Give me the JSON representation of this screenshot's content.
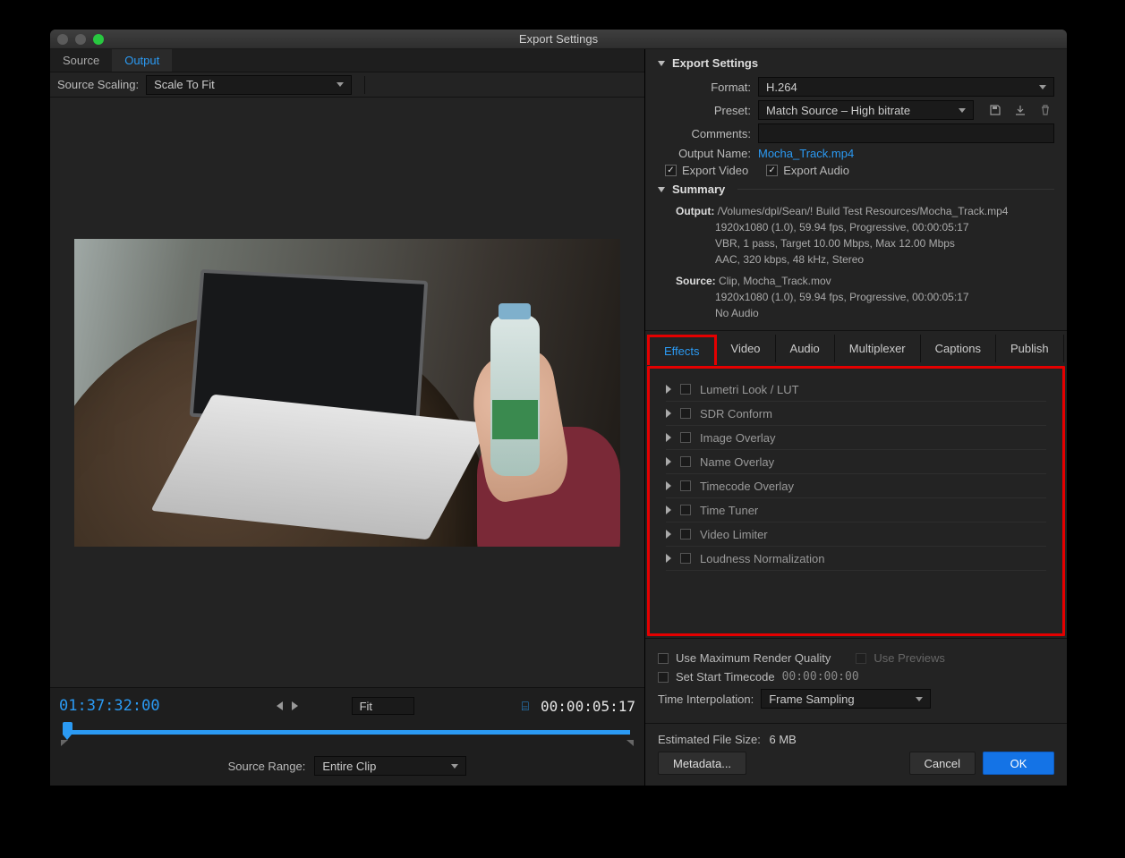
{
  "window": {
    "title": "Export Settings"
  },
  "left": {
    "tabs": [
      "Source",
      "Output"
    ],
    "active_tab": "Output",
    "scaling_label": "Source Scaling:",
    "scaling_value": "Scale To Fit",
    "timecode_in": "01:37:32:00",
    "timecode_out": "00:00:05:17",
    "zoom_value": "Fit",
    "range_label": "Source Range:",
    "range_value": "Entire Clip"
  },
  "export": {
    "header": "Export Settings",
    "format_label": "Format:",
    "format_value": "H.264",
    "preset_label": "Preset:",
    "preset_value": "Match Source – High bitrate",
    "comments_label": "Comments:",
    "output_name_label": "Output Name:",
    "output_name_value": "Mocha_Track.mp4",
    "export_video_label": "Export Video",
    "export_audio_label": "Export Audio",
    "summary_header": "Summary",
    "summary": {
      "output_label": "Output:",
      "output_path": "/Volumes/dpl/Sean/! Build Test Resources/Mocha_Track.mp4",
      "output_line2": "1920x1080 (1.0), 59.94 fps, Progressive, 00:00:05:17",
      "output_line3": "VBR, 1 pass, Target 10.00 Mbps, Max 12.00 Mbps",
      "output_line4": "AAC, 320 kbps, 48 kHz, Stereo",
      "source_label": "Source:",
      "source_line1": "Clip, Mocha_Track.mov",
      "source_line2": "1920x1080 (1.0), 59.94 fps, Progressive, 00:00:05:17",
      "source_line3": "No Audio"
    }
  },
  "settings_tabs": [
    "Effects",
    "Video",
    "Audio",
    "Multiplexer",
    "Captions",
    "Publish"
  ],
  "settings_active": "Effects",
  "effects": [
    "Lumetri Look / LUT",
    "SDR Conform",
    "Image Overlay",
    "Name Overlay",
    "Timecode Overlay",
    "Time Tuner",
    "Video Limiter",
    "Loudness Normalization"
  ],
  "bottom": {
    "max_render": "Use Maximum Render Quality",
    "use_previews": "Use Previews",
    "set_start": "Set Start Timecode",
    "start_tc": "00:00:00:00",
    "interp_label": "Time Interpolation:",
    "interp_value": "Frame Sampling",
    "est_label": "Estimated File Size:",
    "est_value": "6 MB",
    "metadata": "Metadata...",
    "cancel": "Cancel",
    "ok": "OK"
  }
}
